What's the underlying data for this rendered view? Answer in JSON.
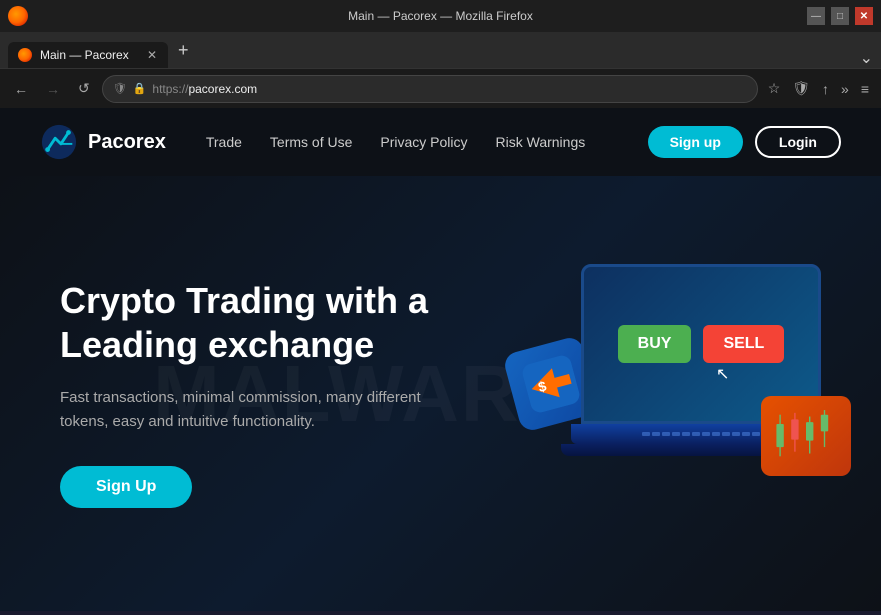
{
  "browser": {
    "title": "Main — Pacorex — Mozilla Firefox",
    "tab_label": "Main — Pacorex",
    "url_https": "https://",
    "url_domain": "pacorex.com",
    "new_tab_label": "+",
    "dropdown_label": "⌄"
  },
  "nav_buttons": {
    "back": "←",
    "forward": "→",
    "refresh": "↺",
    "bookmark": "☆",
    "shield": "⊕",
    "share": "↑",
    "more": "»",
    "menu": "≡"
  },
  "site": {
    "logo_text": "Pacorex",
    "nav_links": [
      {
        "label": "Trade"
      },
      {
        "label": "Terms of Use"
      },
      {
        "label": "Privacy Policy"
      },
      {
        "label": "Risk Warnings"
      }
    ],
    "btn_signup": "Sign up",
    "btn_login": "Login",
    "hero": {
      "title": "Crypto Trading with a Leading exchange",
      "subtitle": "Fast transactions, minimal commission, many different tokens, easy and intuitive functionality.",
      "cta": "Sign Up"
    },
    "watermark": "MALWARE.COM",
    "trade_buy": "BUY",
    "trade_sell": "SELL"
  }
}
